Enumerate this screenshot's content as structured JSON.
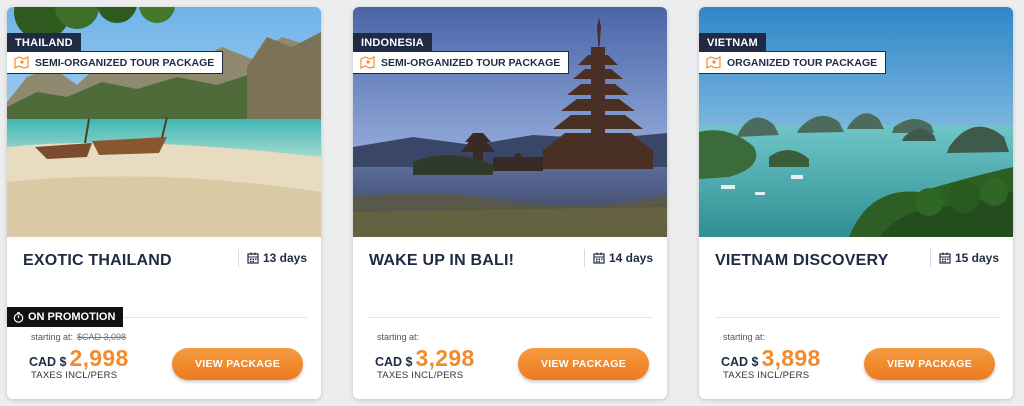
{
  "colors": {
    "navy": "#1f2a44",
    "orange": "#f28a2e",
    "promo_black": "#111111"
  },
  "icons": {
    "package": "map-icon",
    "duration": "calendar-icon",
    "promotion": "stopwatch-icon"
  },
  "cards": [
    {
      "country": "THAILAND",
      "package_type": "SEMI-ORGANIZED TOUR PACKAGE",
      "title": "EXOTIC THAILAND",
      "days": "13 days",
      "promotion": "ON PROMOTION",
      "starting_label": "starting at:",
      "old_price": "$CAD 3,098",
      "currency": "CAD $",
      "price": "2,998",
      "taxes": "TAXES INCL/PERS",
      "button": "VIEW PACKAGE"
    },
    {
      "country": "INDONESIA",
      "package_type": "SEMI-ORGANIZED TOUR PACKAGE",
      "title": "WAKE UP IN BALI!",
      "days": "14 days",
      "starting_label": "starting at:",
      "currency": "CAD $",
      "price": "3,298",
      "taxes": "TAXES INCL/PERS",
      "button": "VIEW PACKAGE"
    },
    {
      "country": "VIETNAM",
      "package_type": "ORGANIZED TOUR PACKAGE",
      "title": "VIETNAM DISCOVERY",
      "days": "15 days",
      "starting_label": "starting at:",
      "currency": "CAD $",
      "price": "3,898",
      "taxes": "TAXES INCL/PERS",
      "button": "VIEW PACKAGE"
    }
  ]
}
